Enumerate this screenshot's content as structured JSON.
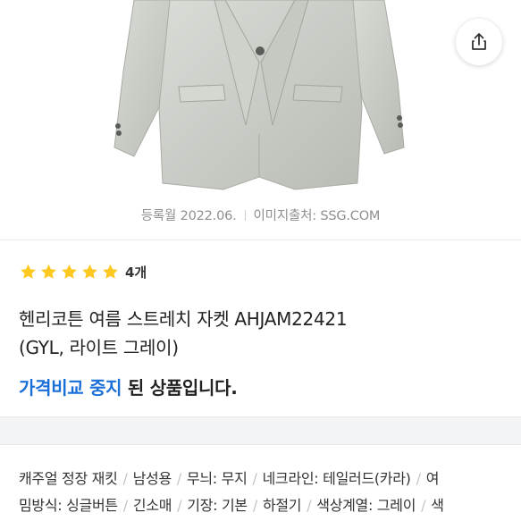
{
  "product": {
    "image_caption": {
      "date": "등록월 2022.06.",
      "source": "이미지출처: SSG.COM"
    },
    "rating": {
      "stars": 5,
      "max": 5,
      "review_count": "4개",
      "star_color": "#FDC820"
    },
    "title_line1": "헨리코튼 여름 스트레치 자켓 AHJAM22421",
    "title_line2": "(GYL, 라이트 그레이)",
    "notice": {
      "highlight": "가격비교 중지",
      "rest": " 된 상품입니다.",
      "highlight_color": "#1A6FD8"
    }
  },
  "share": {
    "icon": "share-icon"
  },
  "specs": {
    "line1": [
      "캐주얼 정장 재킷",
      "남성용",
      "무늬: 무지",
      "네크라인: 테일러드(카라)",
      "여"
    ],
    "line2": [
      "밈방식: 싱글버튼",
      "긴소매",
      "기장: 기본",
      "하절기",
      "색상계열: 그레이",
      "색"
    ]
  }
}
